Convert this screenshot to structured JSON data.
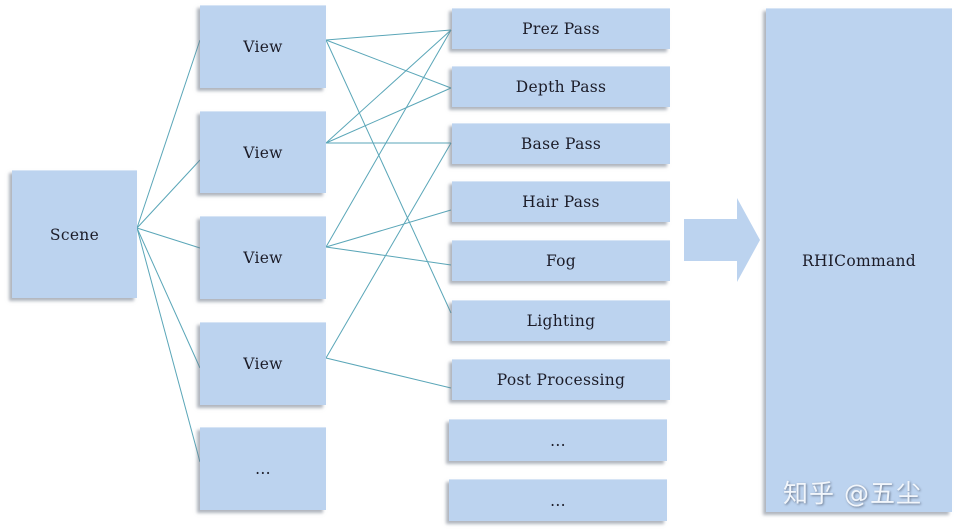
{
  "colors": {
    "box_fill": "#bcd3ef",
    "connector": "#5aa6b8",
    "text": "#1c1c28"
  },
  "scene": {
    "label": "Scene"
  },
  "views": [
    {
      "label": "View"
    },
    {
      "label": "View"
    },
    {
      "label": "View"
    },
    {
      "label": "View"
    },
    {
      "label": "..."
    }
  ],
  "passes": [
    {
      "label": "Prez Pass"
    },
    {
      "label": "Depth Pass"
    },
    {
      "label": "Base Pass"
    },
    {
      "label": "Hair Pass"
    },
    {
      "label": "Fog"
    },
    {
      "label": "Lighting"
    },
    {
      "label": "Post Processing"
    },
    {
      "label": "..."
    },
    {
      "label": "..."
    }
  ],
  "arrow": {
    "icon": "right-arrow-icon"
  },
  "target": {
    "label": "RHICommand"
  },
  "watermark": {
    "text": "知乎 @五尘"
  },
  "connections": {
    "scene_to_views": [
      0,
      1,
      2,
      3,
      4
    ],
    "views_to_passes": [
      {
        "view": 0,
        "passes": [
          0,
          1,
          5
        ]
      },
      {
        "view": 1,
        "passes": [
          0,
          1,
          2
        ]
      },
      {
        "view": 2,
        "passes": [
          0,
          3,
          4
        ]
      },
      {
        "view": 3,
        "passes": [
          2,
          6
        ]
      }
    ]
  }
}
